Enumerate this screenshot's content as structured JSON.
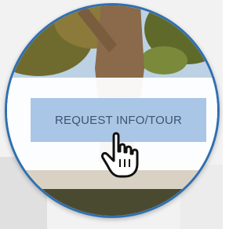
{
  "cta": {
    "label": "REQUEST INFO/TOUR"
  },
  "icons": {
    "cursor": "hand-pointer-icon"
  },
  "colors": {
    "lens_border": "#2f6fb0",
    "button_bg": "#aac6e6",
    "button_text": "#3a5570",
    "band": "#ffffff"
  }
}
